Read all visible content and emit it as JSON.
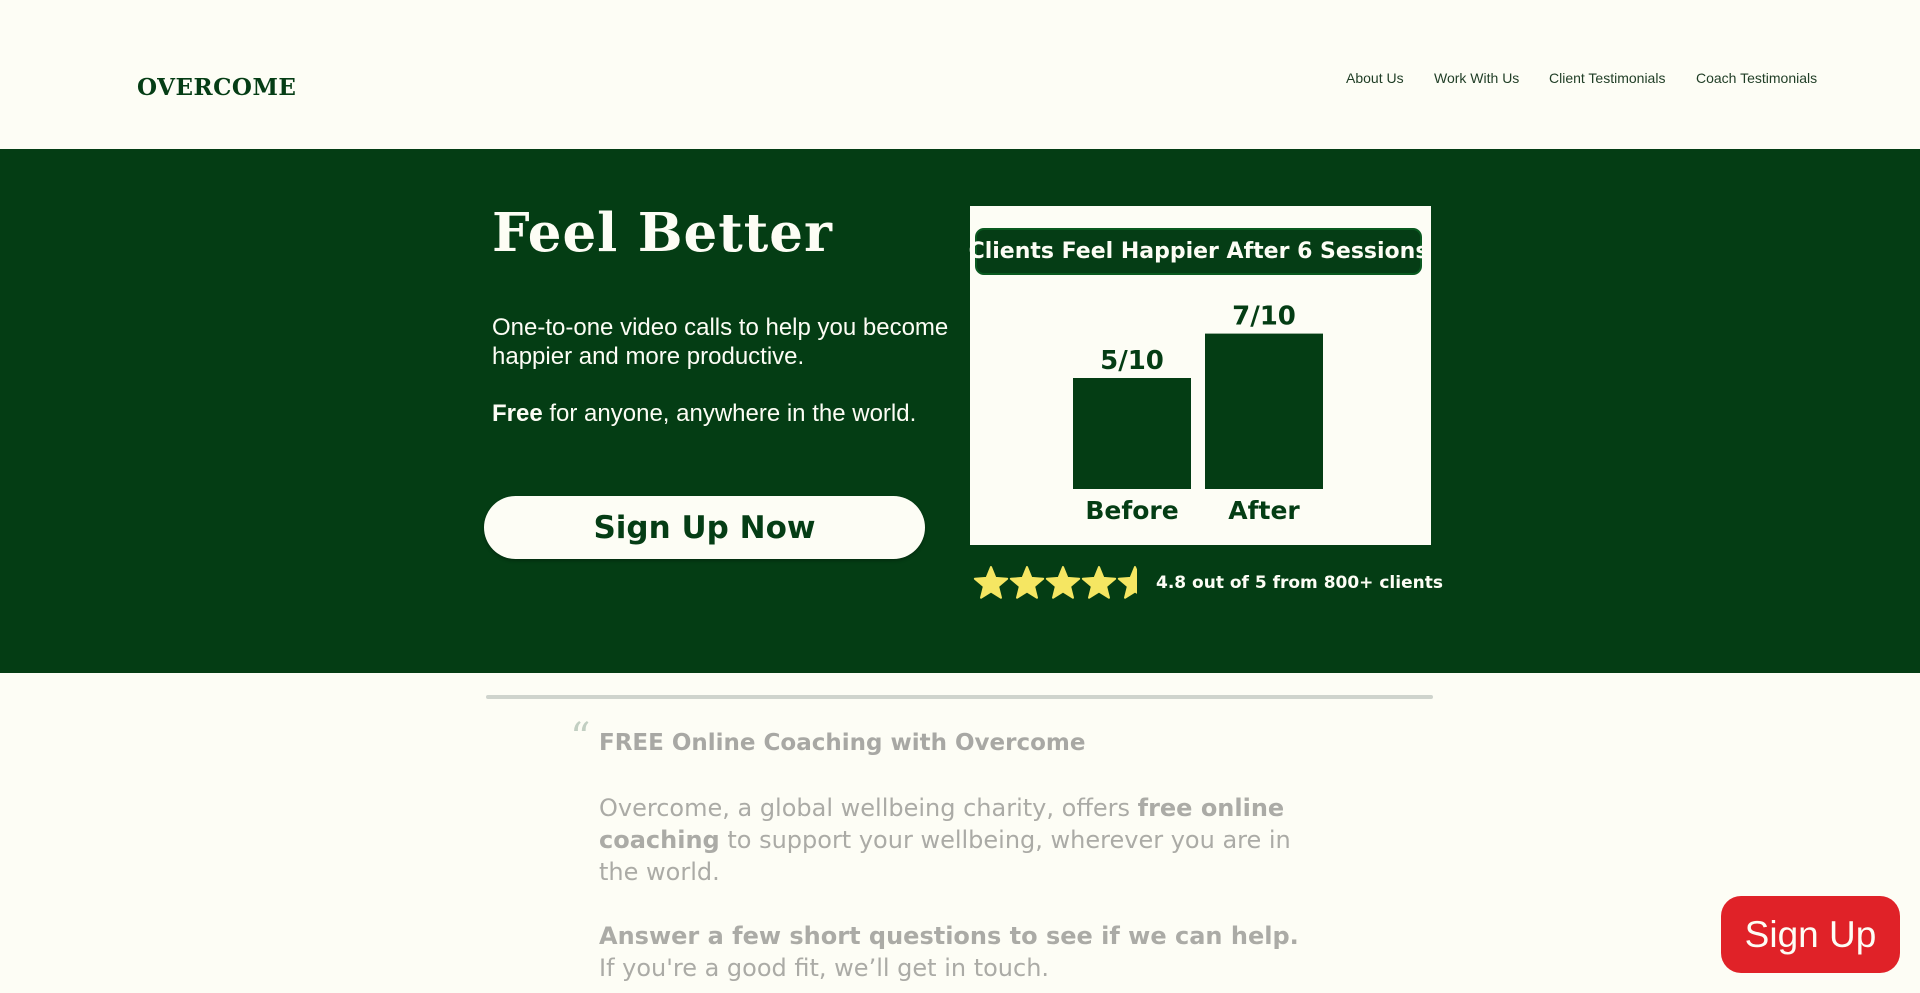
{
  "header": {
    "logo": "OVERCOME",
    "nav": [
      {
        "label": "About Us"
      },
      {
        "label": "Work With Us"
      },
      {
        "label": "Client Testimonials"
      },
      {
        "label": "Coach Testimonials"
      }
    ]
  },
  "hero": {
    "title": "Feel Better",
    "description": "One-to-one video calls to help you become happier and more productive.",
    "free_bold": "Free",
    "free_rest": " for anyone, anywhere in the world.",
    "cta_label": "Sign Up Now"
  },
  "chart_data": {
    "type": "bar",
    "title": "Clients Feel Happier After 6 Sessions",
    "categories": [
      "Before",
      "After"
    ],
    "values": [
      5,
      7
    ],
    "data_labels": [
      "5/10",
      "7/10"
    ],
    "ylim": [
      0,
      10
    ],
    "colors": {
      "bar": "#043d14",
      "background": "#fdfdf5"
    }
  },
  "rating": {
    "stars": 4.5,
    "text": "4.8 out of 5 from 800+ clients",
    "star_color": "#f5e662"
  },
  "intro": {
    "quote_mark": "“",
    "title": "FREE Online Coaching with Overcome",
    "p1_a": "Overcome, a global wellbeing charity, offers ",
    "p1_b": "free online coaching",
    "p1_c": " to support your wellbeing, wherever you are in the world.",
    "p2_a": "Answer a few short questions to see if we can help.",
    "p2_b": " If you're a good fit, we’ll get in touch."
  },
  "floating_button": {
    "label": "Sign Up"
  },
  "colors": {
    "brand_green": "#043d14",
    "cream": "#fdfdf5",
    "signup_red": "#e02228"
  }
}
